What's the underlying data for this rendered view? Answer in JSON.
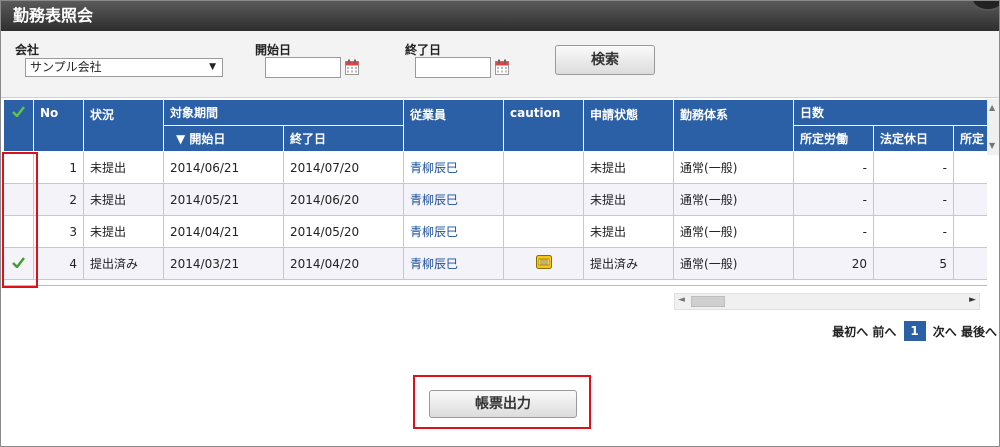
{
  "window": {
    "title": "勤務表照会"
  },
  "search": {
    "company_label": "会社",
    "company_value": "サンプル会社",
    "start_label": "開始日",
    "end_label": "終了日",
    "search_button": "検索"
  },
  "table": {
    "headers": {
      "no": "No",
      "status": "状況",
      "period": "対象期間",
      "start": "▼ 開始日",
      "end": "終了日",
      "employee": "従業員",
      "caution": "caution",
      "app_status": "申請状態",
      "work_system": "勤務体系",
      "days": "日数",
      "scheduled_work": "所定労働",
      "legal_holiday": "法定休日",
      "scheduled_holiday": "所定"
    },
    "rows": [
      {
        "no": "1",
        "status": "未提出",
        "start": "2014/06/21",
        "end": "2014/07/20",
        "employee": "青柳辰巳",
        "caution": "",
        "app_status": "未提出",
        "work_system": "通常(一般)",
        "scheduled_work": "-",
        "legal_holiday": "-",
        "checked": false
      },
      {
        "no": "2",
        "status": "未提出",
        "start": "2014/05/21",
        "end": "2014/06/20",
        "employee": "青柳辰巳",
        "caution": "",
        "app_status": "未提出",
        "work_system": "通常(一般)",
        "scheduled_work": "-",
        "legal_holiday": "-",
        "checked": false
      },
      {
        "no": "3",
        "status": "未提出",
        "start": "2014/04/21",
        "end": "2014/05/20",
        "employee": "青柳辰巳",
        "caution": "",
        "app_status": "未提出",
        "work_system": "通常(一般)",
        "scheduled_work": "-",
        "legal_holiday": "-",
        "checked": false
      },
      {
        "no": "4",
        "status": "提出済み",
        "start": "2014/03/21",
        "end": "2014/04/20",
        "employee": "青柳辰巳",
        "caution": "caution-icon",
        "app_status": "提出済み",
        "work_system": "通常(一般)",
        "scheduled_work": "20",
        "legal_holiday": "5",
        "checked": true
      }
    ]
  },
  "pager": {
    "first": "最初へ",
    "prev": "前へ",
    "current": "1",
    "next": "次へ",
    "last": "最後へ"
  },
  "actions": {
    "print_button": "帳票出力"
  },
  "colors": {
    "header_blue": "#2b5fa6",
    "highlight_red": "#e0101a",
    "check_green": "#3aa02e",
    "link_blue": "#1a4f9c"
  }
}
